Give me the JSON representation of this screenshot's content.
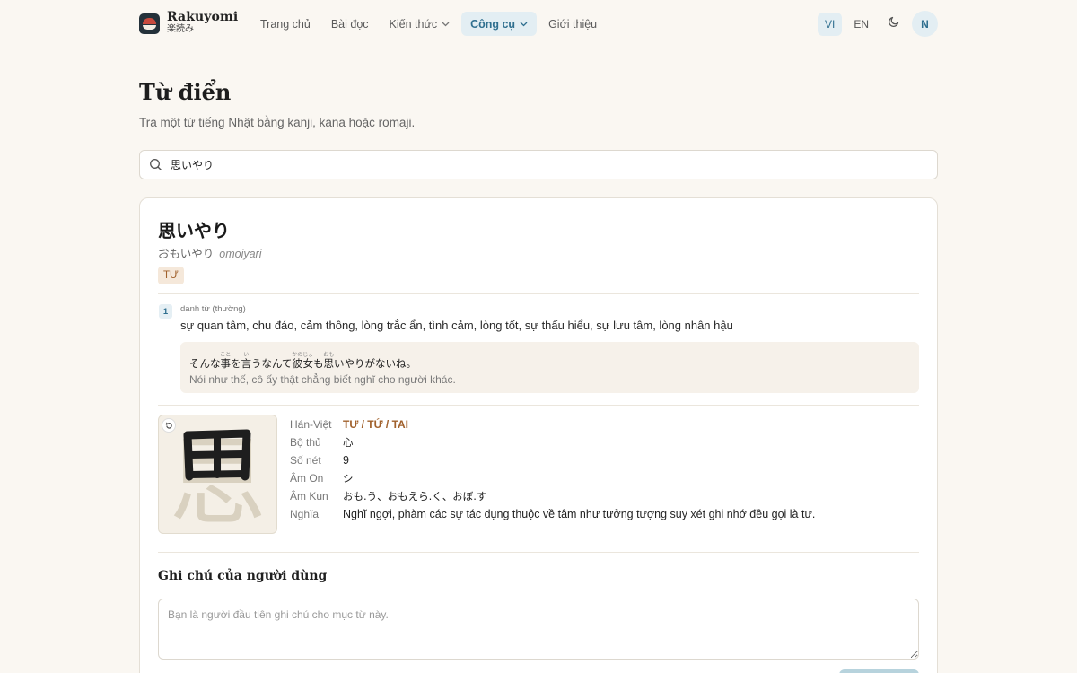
{
  "header": {
    "brand": "Rakuyomi",
    "brand_sub": "楽読み",
    "nav": [
      {
        "label": "Trang chủ"
      },
      {
        "label": "Bài đọc"
      },
      {
        "label": "Kiến thức"
      },
      {
        "label": "Công cụ"
      },
      {
        "label": "Giới thiệu"
      }
    ],
    "lang_vi": "VI",
    "lang_en": "EN",
    "avatar": "N"
  },
  "page": {
    "title": "Từ điển",
    "subtitle": "Tra một từ tiếng Nhật bằng kanji, kana hoặc romaji."
  },
  "search": {
    "value": "思いやり"
  },
  "entry": {
    "word": "思いやり",
    "kana": "おもいやり",
    "romaji": "omoiyari",
    "tag": "TƯ",
    "sense": {
      "number": "1",
      "pos": "danh từ (thường)",
      "gloss": "sự quan tâm, chu đáo, cảm thông, lòng trắc ẩn, tình cảm, lòng tốt, sự thấu hiểu, sự lưu tâm, lòng nhân hậu",
      "example_jp": {
        "p1": "そんな",
        "r1_base": "事",
        "r1_rt": "こと",
        "p2": "を",
        "r2_base": "言",
        "r2_rt": "い",
        "p3": "うなんて",
        "r3_base": "彼女",
        "r3_rt": "かのじょ",
        "p4": "も",
        "r4_base": "思",
        "r4_rt": "おも",
        "p5": "いやりがないね。"
      },
      "example_vi": "Nói như thế, cô ấy thật chẳng biết nghĩ cho người khác."
    }
  },
  "kanji": {
    "character": "思",
    "rows": [
      {
        "label": "Hán-Việt",
        "value": "TƯ / TỨ / TAI"
      },
      {
        "label": "Bộ thủ",
        "value": "心"
      },
      {
        "label": "Số nét",
        "value": "9"
      },
      {
        "label": "Âm On",
        "value": "シ"
      },
      {
        "label": "Âm Kun",
        "value": "おも.う、おもえら.く、おぼ.す"
      },
      {
        "label": "Nghĩa",
        "value": "Nghĩ ngợi, phàm các sự tác dụng thuộc về tâm như tưởng tượng suy xét ghi nhớ đều gọi là tư."
      }
    ]
  },
  "notes": {
    "title": "Ghi chú của người dùng",
    "placeholder": "Bạn là người đầu tiên ghi chú cho mục từ này."
  },
  "colors": {
    "accent": "#2f6f8f",
    "accent_bg": "#e3eef3",
    "brand_tag": "#a0602b",
    "page_bg": "#faf7f2"
  }
}
